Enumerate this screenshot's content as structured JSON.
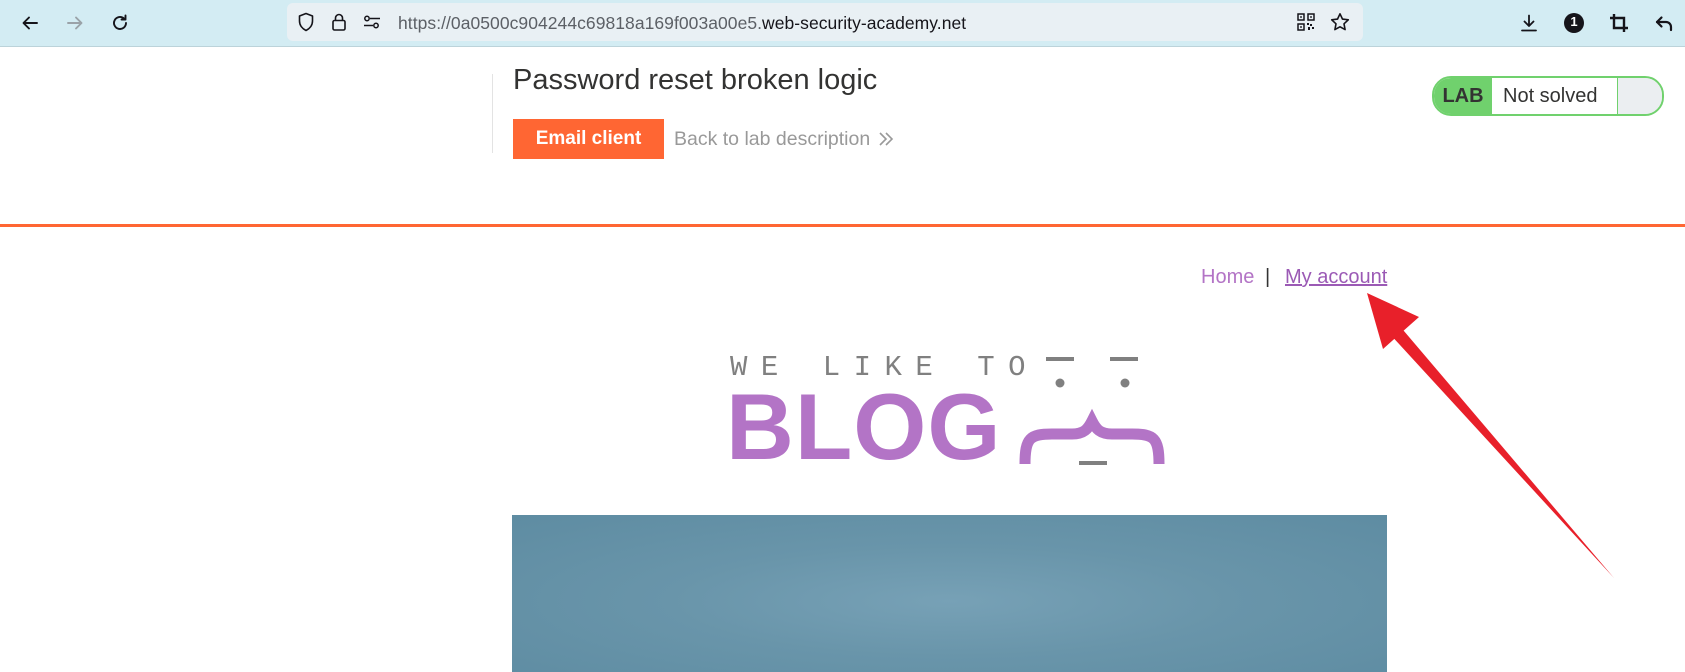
{
  "browser": {
    "url_prefix": "https://0a0500c904244c69818a169f003a00e5.",
    "url_domain": "web-security-academy.net",
    "extension_badge": "1",
    "icons": [
      "back-icon",
      "forward-icon",
      "reload-icon",
      "shield-icon",
      "lock-icon",
      "permissions-icon",
      "qr-code-icon",
      "star-icon",
      "download-icon",
      "extension-icon",
      "crop-icon",
      "undo-icon"
    ]
  },
  "lab_header": {
    "title": "Password reset broken logic",
    "email_client_label": "Email client",
    "back_link_label": "Back to lab description",
    "badge_label": "LAB",
    "status_label": "Not solved",
    "accent_color": "#ff6633",
    "status_color": "#70d16d"
  },
  "blog_nav": {
    "home_label": "Home",
    "separator": "|",
    "my_account_label": "My account",
    "link_color": "#b374c6"
  },
  "logo": {
    "tagline": "WE LIKE TO",
    "word": "BLOG"
  },
  "annotation": {
    "arrow_color": "#e8202a"
  }
}
